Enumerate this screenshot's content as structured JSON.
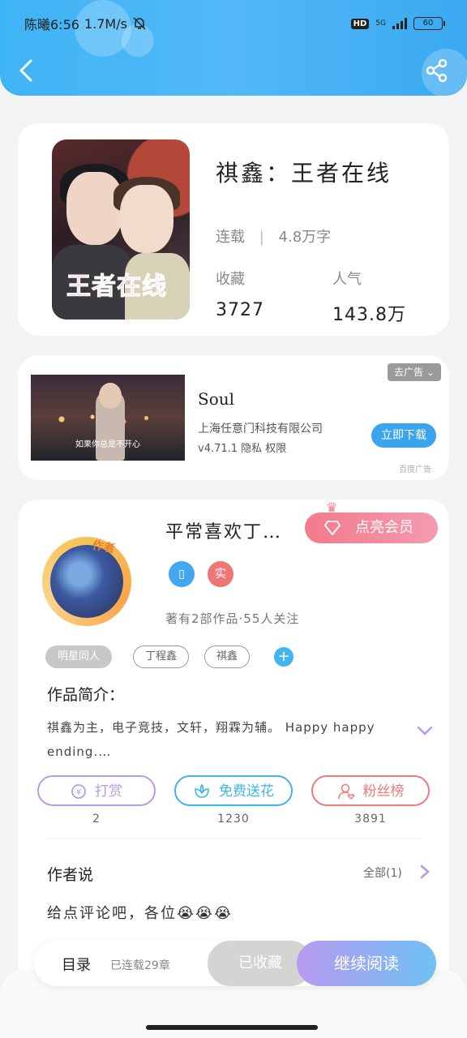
{
  "status_bar": {
    "time_text": "陈曦6:56",
    "net_speed": "1.7M/s",
    "hd": "HD",
    "network": "5G",
    "battery": "60"
  },
  "book": {
    "cover_title": "王者在线",
    "title": "祺鑫：王者在线",
    "status": "连载",
    "word_count": "4.8万字",
    "collect_label": "收藏",
    "collect_value": "3727",
    "popularity_label": "人气",
    "popularity_value": "143.8万"
  },
  "ad": {
    "caption": "如果你总是不开心",
    "title": "Soul",
    "company": "上海任意门科技有限公司",
    "version": "v4.71.1 隐私 权限",
    "button": "立即下载",
    "close": "去广告",
    "tag": "百度广告"
  },
  "author": {
    "badge": "作者",
    "name": "平常喜欢丁…",
    "vip_button": "点亮会员",
    "real_badge": "实",
    "stats": "著有2部作品·55人关注",
    "tags": [
      "明星同人",
      "丁程鑫",
      "祺鑫"
    ],
    "add_tag": "+",
    "intro_title": "作品简介：",
    "intro_text": "祺鑫为主，电子竞技，文轩，翔霖为辅。 Happy happy ending.…",
    "actions": [
      {
        "label": "打赏",
        "count": "2",
        "color": "#b99ae6"
      },
      {
        "label": "免费送花",
        "count": "1230",
        "color": "#3fb6e8"
      },
      {
        "label": "粉丝榜",
        "count": "3891",
        "color": "#ee7a7a"
      }
    ],
    "say_title": "作者说",
    "say_all": "全部(1)",
    "say_text": "给点评论吧，各位😭😭😭"
  },
  "bottom_bar": {
    "toc": "目录",
    "update": "已连载29章",
    "collected": "已收藏",
    "continue": "继续阅读"
  }
}
